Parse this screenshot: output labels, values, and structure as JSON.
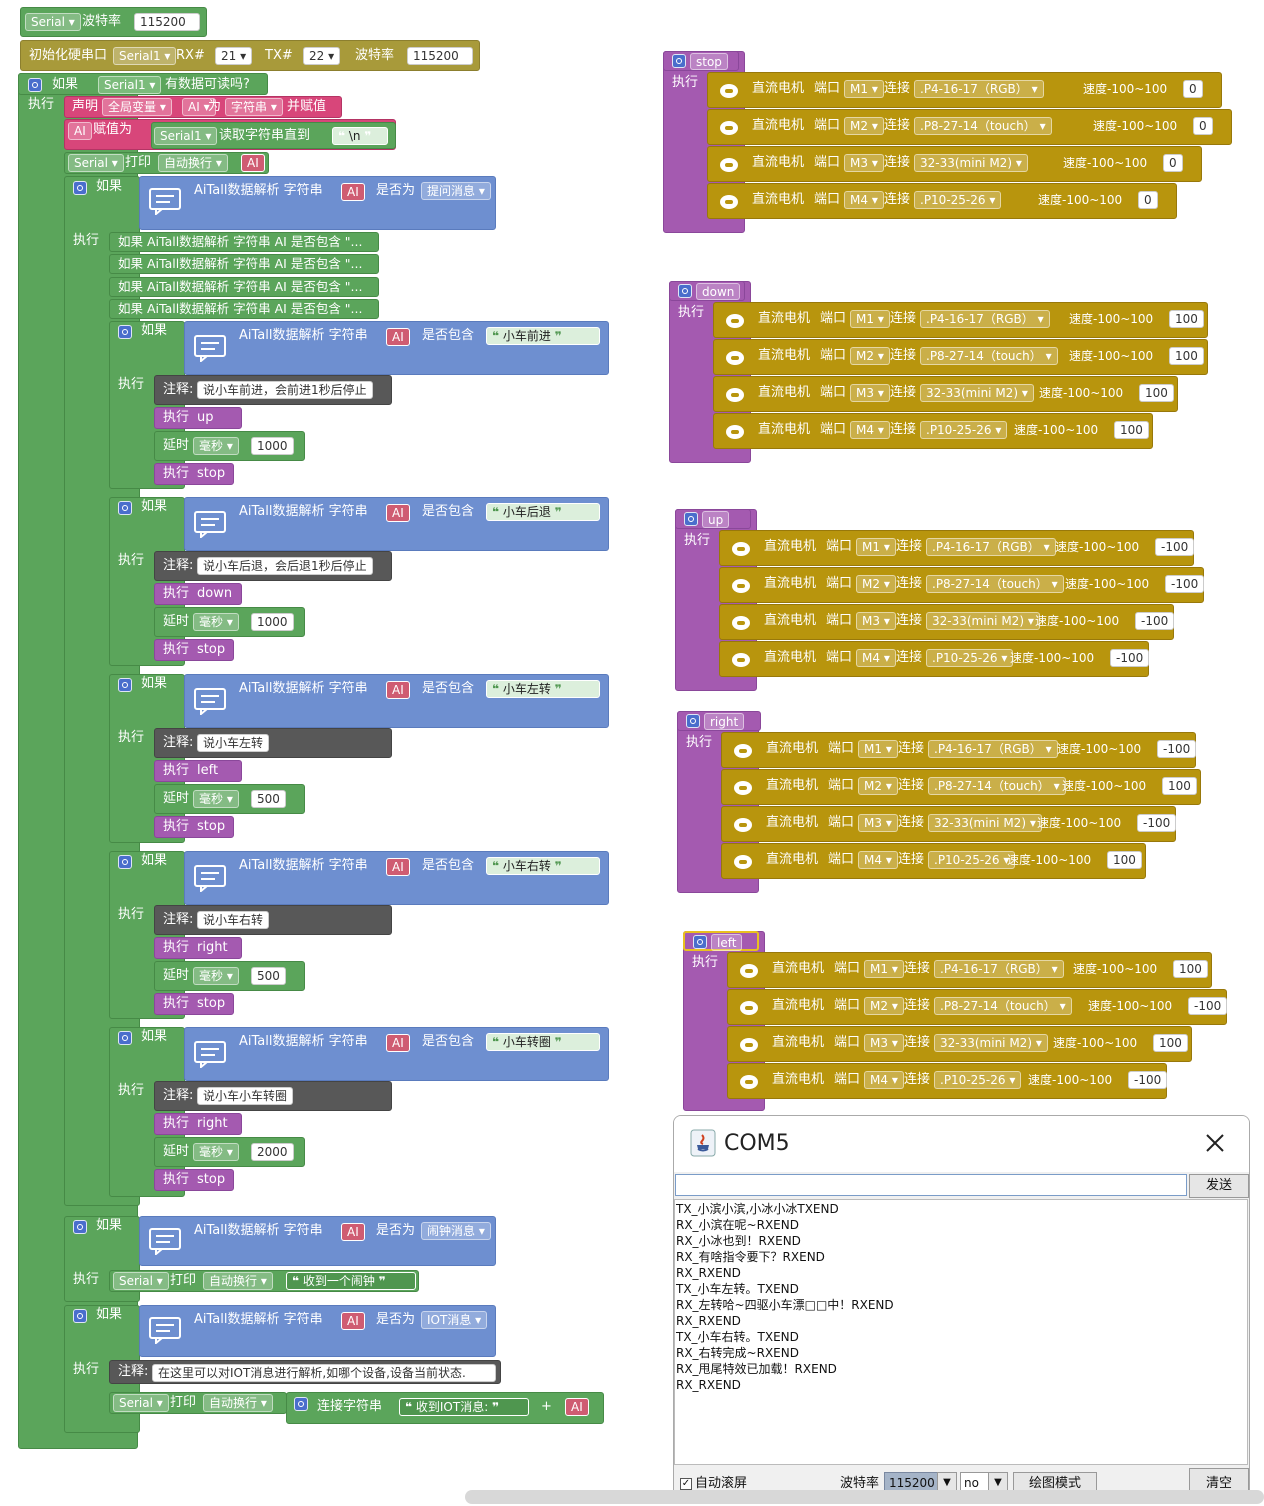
{
  "top": {
    "serial_label": "Serial",
    "baud_label": "波特率",
    "baud_value": "115200",
    "init_label": "初始化硬串口",
    "init_port": "Serial1",
    "rx_label": "RX#",
    "rx_value": "21",
    "tx_label": "TX#",
    "tx_value": "22",
    "init_baud_label": "波特率",
    "init_baud_value": "115200"
  },
  "main": {
    "if": "如果",
    "do": "执行",
    "serial1": "Serial1",
    "available": "有数据可读吗?",
    "declare": "声明",
    "global": "全局变量",
    "ai": "AI",
    "as": "为",
    "string": "字符串",
    "and_assign": "并赋值",
    "ai_assign": "AI",
    "assign_label": "赋值为",
    "read_label": "读取字符串直到",
    "read_delim": "\\n",
    "serial": "Serial",
    "print": "打印",
    "newline": "自动换行",
    "parse": "AiTall数据解析 字符串",
    "is": "是否为",
    "contains": "是否包含",
    "q_msg": "提问消息",
    "alarm_msg": "闹钟消息",
    "iot_msg": "IOT消息",
    "collapsed": [
      "如果 AiTall数据解析 字符串 AI 是否包含 \"...",
      "如果 AiTall数据解析 字符串 AI 是否包含 \"...",
      "如果 AiTall数据解析 字符串 AI 是否包含 \"...",
      "如果 AiTall数据解析 字符串 AI 是否包含 \"..."
    ],
    "comment": "注释:",
    "exec": "执行",
    "delay": "延时",
    "ms": "毫秒",
    "cmds": [
      {
        "key": "小车前进",
        "note": "说小车前进，会前进1秒后停止",
        "fn": "up",
        "delay": "1000",
        "stop": "stop"
      },
      {
        "key": "小车后退",
        "note": "说小车后退，会后退1秒后停止",
        "fn": "down",
        "delay": "1000",
        "stop": "stop"
      },
      {
        "key": "小车左转",
        "note": "说小车左转",
        "fn": "left",
        "delay": "500",
        "stop": "stop"
      },
      {
        "key": "小车右转",
        "note": "说小车右转",
        "fn": "right",
        "delay": "500",
        "stop": "stop"
      },
      {
        "key": "小车转圈",
        "note": "说小车小车转圈",
        "fn": "right",
        "delay": "2000",
        "stop": "stop"
      }
    ],
    "alarm_print": "收到一个闹钟",
    "iot_note": "在这里可以对IOT消息进行解析,如哪个设备,设备当前状态.",
    "concat": "连接字符串",
    "iot_print": "收到IOT消息:",
    "plus": "+"
  },
  "funcs": [
    {
      "name": "stop",
      "do": "执行",
      "speeds": [
        "0",
        "0",
        "0",
        "0"
      ]
    },
    {
      "name": "down",
      "do": "执行",
      "speeds": [
        "100",
        "100",
        "100",
        "100"
      ]
    },
    {
      "name": "up",
      "do": "执行",
      "speeds": [
        "-100",
        "-100",
        "-100",
        "-100"
      ]
    },
    {
      "name": "right",
      "do": "执行",
      "speeds": [
        "-100",
        "100",
        "-100",
        "100"
      ]
    },
    {
      "name": "left",
      "do": "执行",
      "speeds": [
        "100",
        "-100",
        "100",
        "-100"
      ]
    }
  ],
  "motor": {
    "label": "直流电机",
    "port": "端口",
    "connect": "连接",
    "speed": "速度-100~100",
    "ports": [
      "M1",
      "M2",
      "M3",
      "M4"
    ],
    "pins": [
      ".P4-16-17（RGB）",
      ".P8-27-14（touch）",
      "32-33(mini M2)",
      ".P10-25-26"
    ]
  },
  "com": {
    "title": "COM5",
    "send": "发送",
    "input": "",
    "lines": [
      "TX_小滨小滨,小冰小冰TXEND",
      "RX_小滨在呢~RXEND",
      "RX_小冰也到！RXEND",
      "RX_有啥指令要下？RXEND",
      "RX_RXEND",
      "TX_小车左转。TXEND",
      "RX_左转哈~四驱小车漂□□中！RXEND",
      "RX_RXEND",
      "TX_小车右转。TXEND",
      "RX_右转完成~RXEND",
      "RX_甩尾特效已加载！RXEND",
      "RX_RXEND"
    ],
    "autoscroll": "自动滚屏",
    "baud_label": "波特率",
    "baud": "115200",
    "parity": "no",
    "plot": "绘图模式",
    "clear": "清空"
  }
}
